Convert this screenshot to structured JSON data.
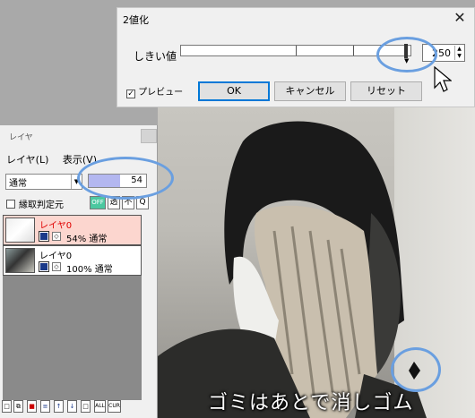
{
  "dialog": {
    "title": "2値化",
    "close_glyph": "✕",
    "threshold_label": "しきい値",
    "threshold_value": "250",
    "threshold_fraction": 0.98,
    "preview_label": "プレビュー",
    "preview_checked": true,
    "ok_label": "OK",
    "cancel_label": "キャンセル",
    "reset_label": "リセット"
  },
  "layer_panel": {
    "title": "レイヤ",
    "menu": [
      "レイヤ(L)",
      "表示(V)"
    ],
    "blend_mode": "通常",
    "opacity": "54",
    "opacity_fraction": 0.54,
    "clip_label": "縁取判定元",
    "buttons": [
      "OFF",
      "透",
      "不",
      "Q"
    ],
    "layers": [
      {
        "name": "レイヤ0",
        "opacity": "54%",
        "mode": "通常",
        "selected": true
      },
      {
        "name": "レイヤ0",
        "opacity": "100%",
        "mode": "通常",
        "selected": false
      }
    ],
    "toolbar_icons": [
      "new-layer-icon",
      "copy-layer-icon",
      "delete-icon",
      "merge-icon",
      "up-icon",
      "down-icon",
      "blank-icon",
      "ALL",
      "CUR"
    ]
  },
  "caption": "ゴミはあとで消しゴム",
  "colors": {
    "highlight": "#6a9fe0",
    "selected_layer": "#fcd6cf",
    "selected_layer_name": "#e00000",
    "opacity_fill": "#b3b7f0"
  }
}
